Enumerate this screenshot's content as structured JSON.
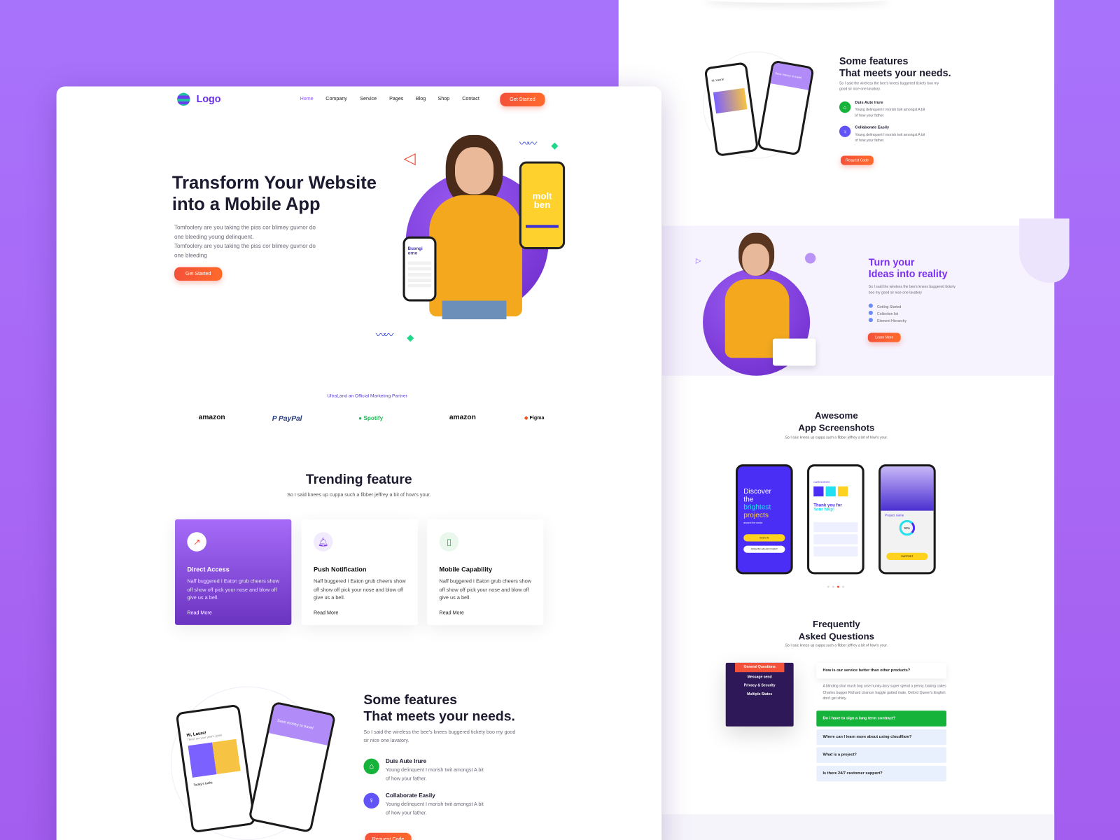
{
  "colors": {
    "brand": "#7c3aed",
    "accent": "#f4513a",
    "green": "#16b33b",
    "bg": "#a86cf7"
  },
  "nav": {
    "logo": "Logo",
    "items": [
      "Home",
      "Company",
      "Service",
      "Pages",
      "Blog",
      "Shop",
      "Contact"
    ],
    "active": "Home",
    "cta": "Get Started"
  },
  "hero": {
    "title_l1": "Transform Your Website",
    "title_l2": "into a Mobile App",
    "p1": "Tomfoolery are you taking the piss cor blimey guvnor do one bleeding young delinquent.",
    "p2": "Tomfoolery are you taking the piss cor blimey guvnor do one bleeding",
    "cta": "Get Started",
    "phone_yellow_text": "molt ben",
    "phone_small_text": "Buongi orno"
  },
  "partners": {
    "heading": "UltraLand an Official Marketing Partner",
    "logos": [
      "amazon",
      "PayPal",
      "Spotify",
      "amazon",
      "Figma"
    ]
  },
  "trending": {
    "title": "Trending feature",
    "subtitle": "So I said knees up cuppa such a fibber jeffrey a bit of how's your.",
    "cards": [
      {
        "icon": "trending-up-icon",
        "title": "Direct Access",
        "text": "Naff buggered I Eaton grub cheers show off show off pick your nose and blow off give us a bell.",
        "link": "Read More"
      },
      {
        "icon": "bell-icon",
        "title": "Push Notification",
        "text": "Naff buggered I Eaton grub cheers show off show off pick your nose and blow off give us a bell.",
        "link": "Read More"
      },
      {
        "icon": "mobile-icon",
        "title": "Mobile Capability",
        "text": "Naff buggered I Eaton grub cheers show off show off pick your nose and blow off give us a bell.",
        "link": "Read More"
      }
    ]
  },
  "features": {
    "title_l1": "Some features",
    "title_l2": "That meets your needs.",
    "text": "So I said the wireless the bee's knees buggered tickety boo my good sir nice one lavatory.",
    "items": [
      {
        "icon": "home-icon",
        "title": "Duis Aute Irure",
        "text": "Young delinquent I morish twit amongst A bit of how your father."
      },
      {
        "icon": "lightbulb-icon",
        "title": "Collaborate Easily",
        "text": "Young delinquent I morish twit amongst A bit of how your father."
      }
    ],
    "cta": "Request Code",
    "phone1_greeting": "Hi, Laura!",
    "phone1_sub": "These are your year's goals",
    "phone1_tasks": "Today's tasks",
    "phone2_banner": "Save money to travel"
  },
  "ideas": {
    "title_l1": "Turn your",
    "title_l2": "Ideas into reality",
    "text": "So I said the wireless the bee's knees buggered tickety boo my good sir nice one lavatory",
    "list": [
      "Getting Started",
      "Collection list",
      "Element Hierarchy"
    ],
    "cta": "Learn More"
  },
  "screens": {
    "title_l1": "Awesome",
    "title_l2": "App Screenshots",
    "subtitle": "So I saic knees up cuppa such a fibber jeffrey a bit of how's your.",
    "s1": {
      "l1": "Discover",
      "l2": "the",
      "l3": "brightest",
      "l4": "projects",
      "sub": "around the world.",
      "b1": "SIGN IN",
      "b2": "CREATE AN ACCOUNT"
    },
    "s2": {
      "cat": "CATEGORIES",
      "t1": "Thank you for",
      "t2": "Your help!"
    },
    "s3": {
      "name": "Project name",
      "pct": "50%",
      "b": "SUPPORT"
    },
    "active_dot": 2,
    "dots": 4
  },
  "faq": {
    "title_l1": "Frequently",
    "title_l2": "Asked Questions",
    "subtitle": "So I saic knees up cuppa such a fibber jeffrey a bit of how's your.",
    "tabs": [
      "General Questions",
      "Message send",
      "Privacy & Security",
      "Multiple States"
    ],
    "q": [
      "How is our service better than other products?",
      "Do i have to sign a long term contract?",
      "Where can I learn more about using cloudflare?",
      "What is a project?",
      "Is there 24/7 customer support?"
    ],
    "answer": "A blinding shot mush bog arse hunky-dory super spend a penny, baking cakes Charles bugger Richard chancer haggle gutted mate, Oxford Queen's English don't get shirty."
  }
}
